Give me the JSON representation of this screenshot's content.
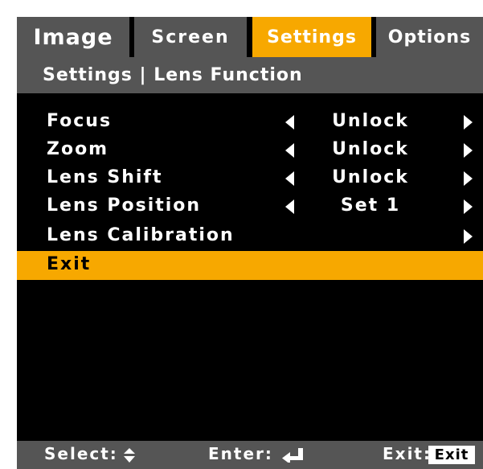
{
  "tabs": [
    {
      "label": "Image"
    },
    {
      "label": "Screen"
    },
    {
      "label": "Settings"
    },
    {
      "label": "Options"
    }
  ],
  "breadcrumb": "Settings | Lens Function",
  "menu": [
    {
      "label": "Focus",
      "value": "Unlock"
    },
    {
      "label": "Zoom",
      "value": "Unlock"
    },
    {
      "label": "Lens Shift",
      "value": "Unlock"
    },
    {
      "label": "Lens Position",
      "value": "Set 1"
    },
    {
      "label": "Lens Calibration"
    },
    {
      "label": "Exit"
    }
  ],
  "footer": {
    "select_label": "Select:",
    "enter_label": "Enter:",
    "exit_label": "Exit:",
    "exit_key": "Exit"
  },
  "colors": {
    "accent": "#f7a800",
    "tab_inactive": "#555555",
    "background": "#000000"
  },
  "icons": [
    "arrow-left-icon",
    "arrow-right-icon",
    "up-down-arrow-icon",
    "enter-key-icon"
  ]
}
